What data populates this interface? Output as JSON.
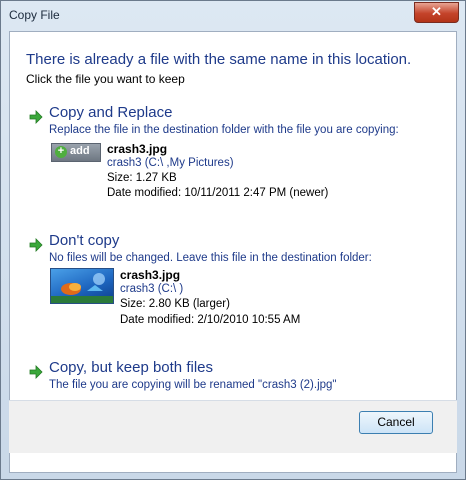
{
  "window": {
    "title": "Copy File",
    "close_glyph": "✕"
  },
  "heading": "There is already a file with the same name in this location.",
  "subheading": "Click the file you want to keep",
  "options": [
    {
      "title": "Copy and Replace",
      "description": "Replace the file in the destination folder with the file you are copying:",
      "thumb_label": "add",
      "file": {
        "name": "crash3.jpg",
        "location": "crash3 (C:\\ ,My Pictures)",
        "size": "Size: 1.27 KB",
        "modified": "Date modified: 10/11/2011 2:47 PM (newer)"
      }
    },
    {
      "title": "Don't copy",
      "description": "No files will be changed. Leave this file in the destination folder:",
      "file": {
        "name": "crash3.jpg",
        "location": "crash3 (C:\\ )",
        "size": "Size: 2.80 KB (larger)",
        "modified": "Date modified: 2/10/2010 10:55 AM"
      }
    },
    {
      "title": "Copy, but keep both files",
      "description": "The file you are copying will be renamed \"crash3 (2).jpg\""
    }
  ],
  "buttons": {
    "cancel": "Cancel"
  },
  "colors": {
    "link_blue": "#1e3a8a",
    "arrow_green": "#3aa83a"
  }
}
